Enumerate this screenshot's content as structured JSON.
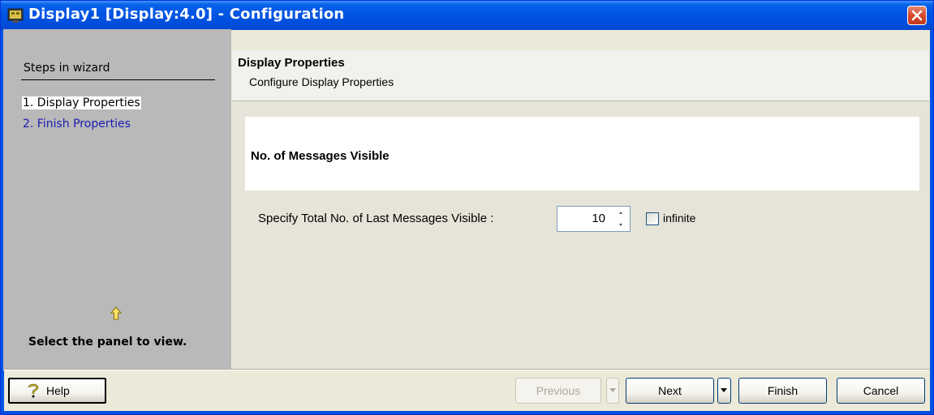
{
  "window": {
    "title": "Display1 [Display:4.0] - Configuration",
    "titlebar_color": "#0055e5"
  },
  "sidebar": {
    "heading": "Steps in wizard",
    "steps": [
      {
        "label": "1. Display Properties",
        "active": true
      },
      {
        "label": "2. Finish Properties",
        "active": false
      }
    ],
    "hint": "Select the panel to view.",
    "hint_icon": "up-arrow-icon"
  },
  "header": {
    "title": "Display Properties",
    "subtitle": "Configure Display Properties"
  },
  "section": {
    "title": "No. of  Messages Visible"
  },
  "form": {
    "label": "Specify Total No. of Last Messages Visible :",
    "value": "10",
    "checkbox_label": "infinite",
    "checkbox_checked": false
  },
  "footer": {
    "help_label": "Help",
    "previous_label": "Previous",
    "next_label": "Next",
    "finish_label": "Finish",
    "cancel_label": "Cancel"
  }
}
